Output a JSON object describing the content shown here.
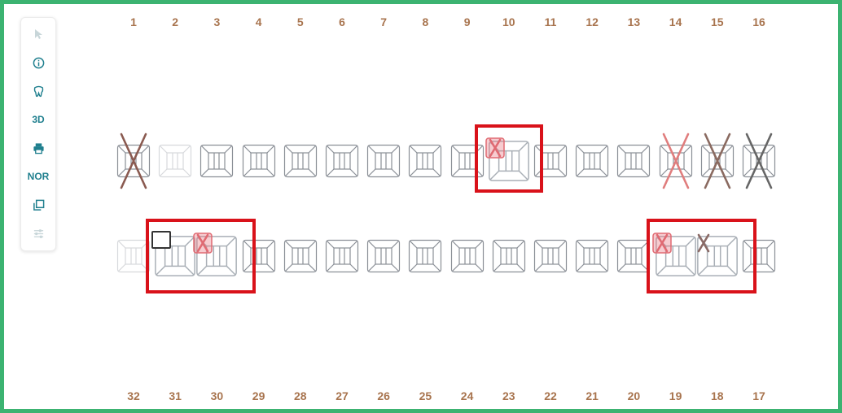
{
  "toolbar": {
    "items": [
      {
        "type": "icon",
        "icon": "cursor-arrow-icon",
        "enabled": false
      },
      {
        "type": "icon",
        "icon": "info-icon",
        "enabled": true
      },
      {
        "type": "icon",
        "icon": "tooth-icon",
        "enabled": true
      },
      {
        "type": "text",
        "label": "3D",
        "enabled": true
      },
      {
        "type": "icon",
        "icon": "printer-icon",
        "enabled": true
      },
      {
        "type": "text",
        "label": "NOR",
        "enabled": true
      },
      {
        "type": "icon",
        "icon": "copy-icon",
        "enabled": true
      },
      {
        "type": "icon",
        "icon": "sliders-icon",
        "enabled": false
      }
    ]
  },
  "upper_numbers": [
    "1",
    "2",
    "3",
    "4",
    "5",
    "6",
    "7",
    "8",
    "9",
    "10",
    "11",
    "12",
    "13",
    "14",
    "15",
    "16"
  ],
  "lower_numbers": [
    "32",
    "31",
    "30",
    "29",
    "28",
    "27",
    "26",
    "25",
    "24",
    "23",
    "22",
    "21",
    "20",
    "19",
    "18",
    "17"
  ],
  "upper_teeth": [
    {
      "n": "1",
      "state": "missing",
      "mark": "#8a5a50"
    },
    {
      "n": "2",
      "state": "faded"
    },
    {
      "n": "3",
      "state": "normal"
    },
    {
      "n": "4",
      "state": "normal"
    },
    {
      "n": "5",
      "state": "normal"
    },
    {
      "n": "6",
      "state": "normal"
    },
    {
      "n": "7",
      "state": "normal"
    },
    {
      "n": "8",
      "state": "normal"
    },
    {
      "n": "9",
      "state": "normal"
    },
    {
      "n": "10",
      "state": "normal",
      "selected": true,
      "flag": "red-x"
    },
    {
      "n": "11",
      "state": "normal"
    },
    {
      "n": "12",
      "state": "normal"
    },
    {
      "n": "13",
      "state": "normal"
    },
    {
      "n": "14",
      "state": "missing",
      "mark": "#e07d7d"
    },
    {
      "n": "15",
      "state": "missing",
      "mark": "#8a6a60"
    },
    {
      "n": "16",
      "state": "missing",
      "mark": "#666666"
    }
  ],
  "lower_teeth": [
    {
      "n": "32",
      "state": "faded"
    },
    {
      "n": "31",
      "state": "normal",
      "selected": true,
      "checkbox": true
    },
    {
      "n": "30",
      "state": "normal",
      "selected": true,
      "flag": "red-x"
    },
    {
      "n": "29",
      "state": "normal"
    },
    {
      "n": "28",
      "state": "normal"
    },
    {
      "n": "27",
      "state": "normal"
    },
    {
      "n": "26",
      "state": "normal"
    },
    {
      "n": "25",
      "state": "normal"
    },
    {
      "n": "24",
      "state": "normal"
    },
    {
      "n": "23",
      "state": "normal"
    },
    {
      "n": "22",
      "state": "normal"
    },
    {
      "n": "21",
      "state": "normal"
    },
    {
      "n": "20",
      "state": "normal"
    },
    {
      "n": "19",
      "state": "normal",
      "selected": true,
      "flag": "red-x"
    },
    {
      "n": "18",
      "state": "normal",
      "selected": true,
      "flag": "dark-x"
    },
    {
      "n": "17",
      "state": "normal"
    }
  ],
  "colors": {
    "frame": "#3cb371",
    "selection": "#d9121a",
    "number": "#a8744e",
    "tooth_stroke": "#8a8f96",
    "toolbar_icon": "#1f7f8e"
  }
}
